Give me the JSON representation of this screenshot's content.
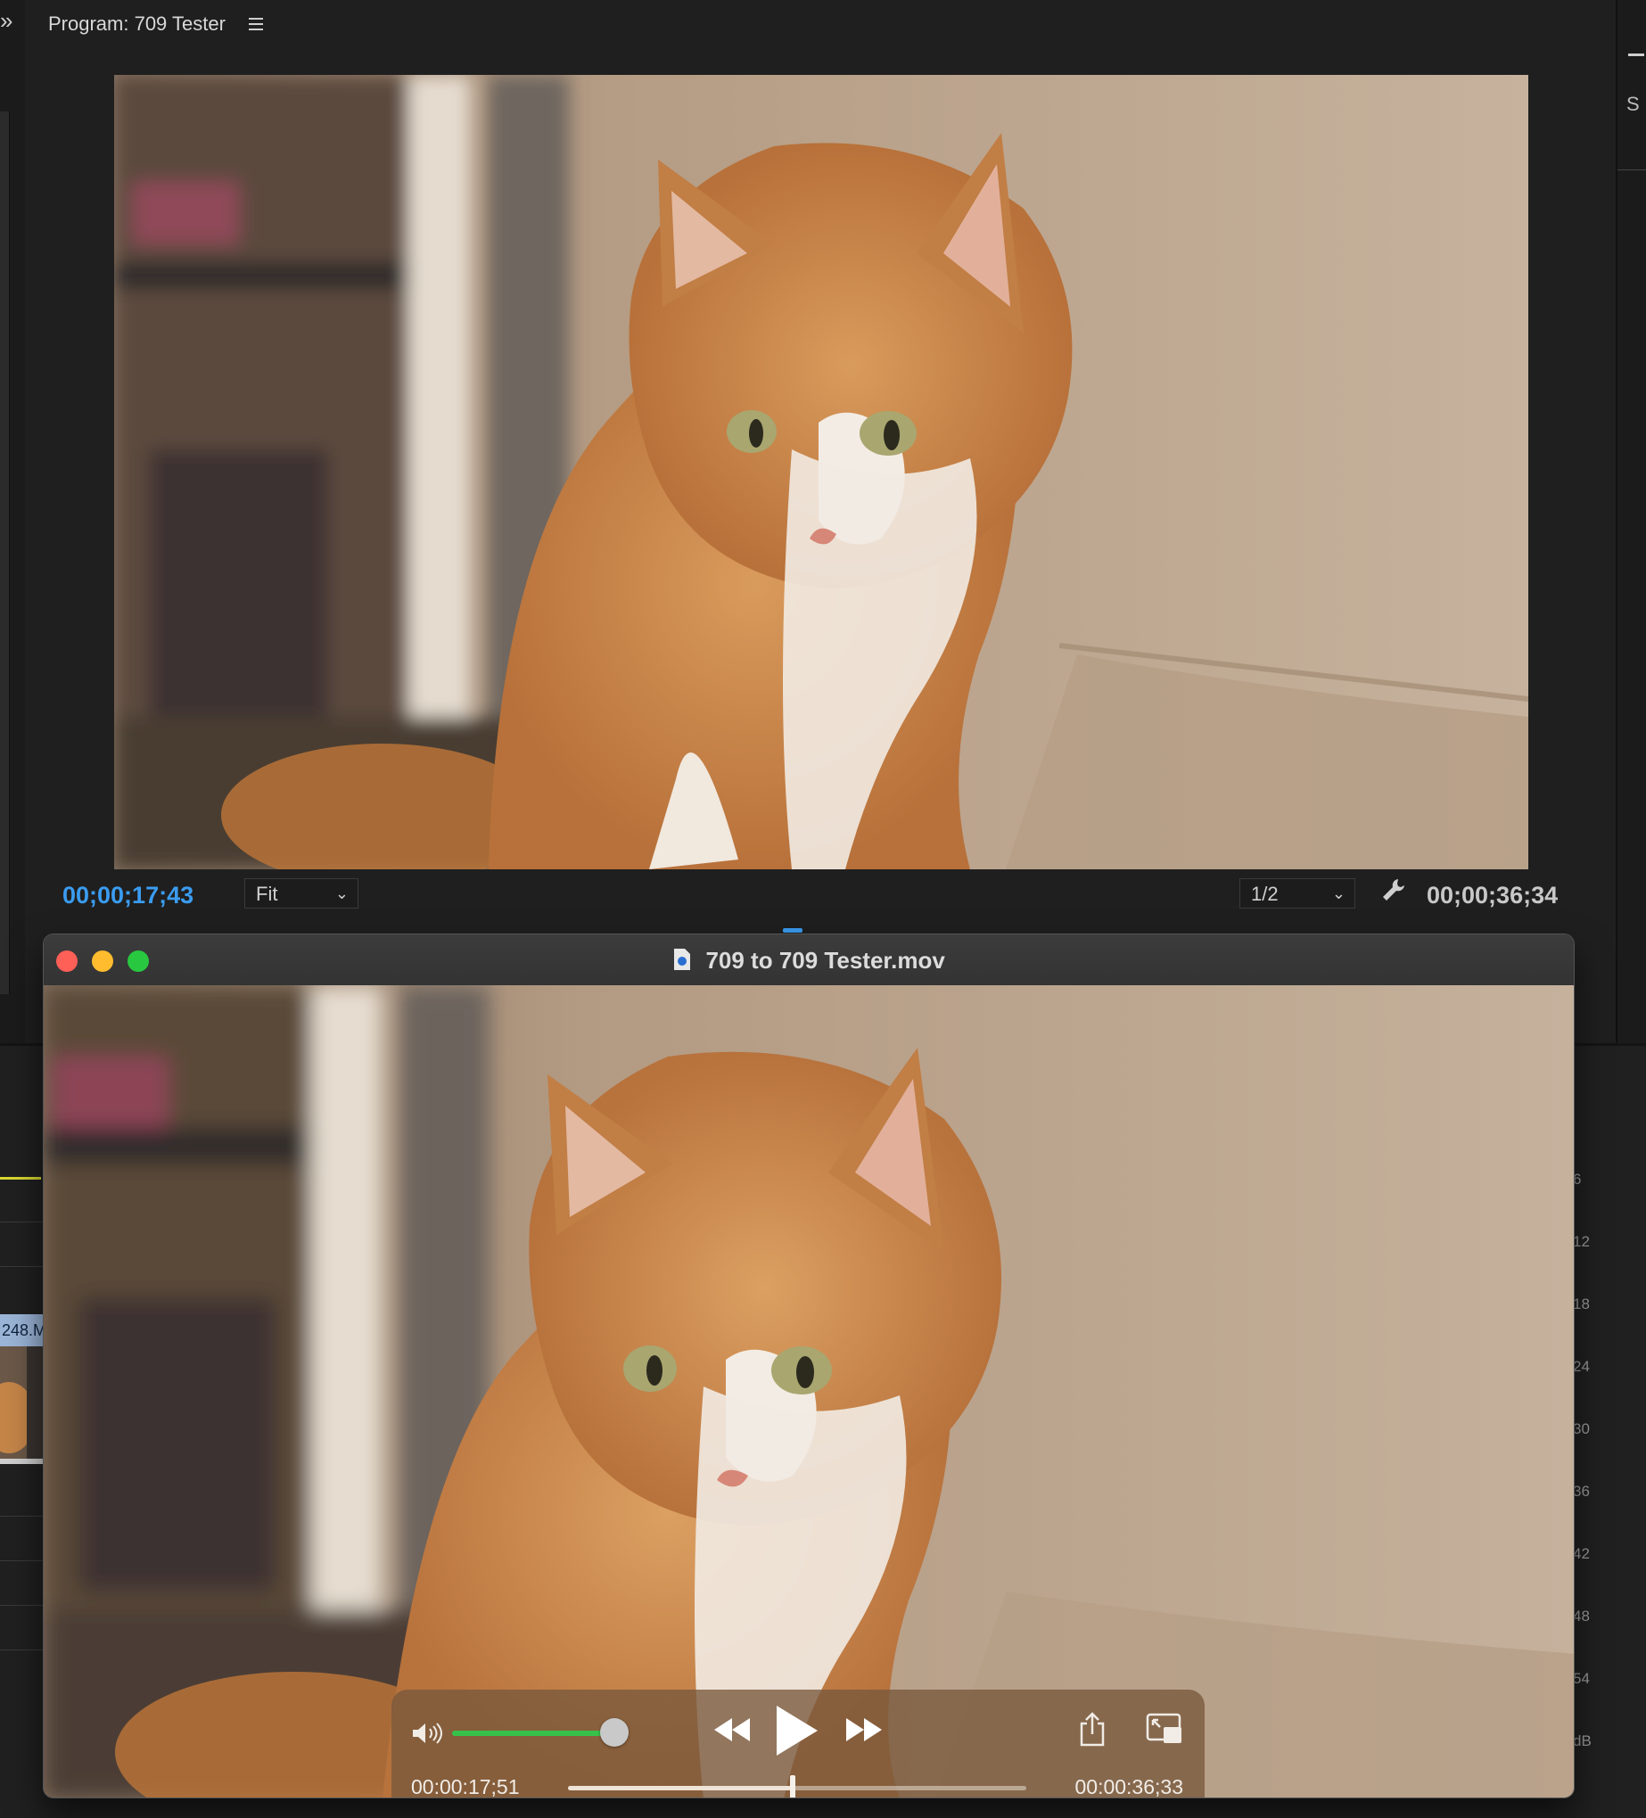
{
  "program_monitor": {
    "title": "Program: 709 Tester",
    "current_timecode": "00;00;17;43",
    "zoom": "Fit",
    "resolution": "1/2",
    "duration_timecode": "00;00;36;34"
  },
  "timeline": {
    "clip_label": "248.M",
    "audio_meter_ticks": [
      "6",
      "12",
      "18",
      "24",
      "30",
      "36",
      "42",
      "48",
      "54",
      "dB"
    ]
  },
  "quicktime": {
    "title": "709 to 709 Tester.mov",
    "elapsed": "00:00:17;51",
    "remaining": "00:00:36;33",
    "volume_level": 0.85,
    "playback_progress": 0.49,
    "colors": {
      "volume": "#36c24a",
      "close": "#fe5f57",
      "minimize": "#febc2e",
      "zoom": "#28c840",
      "timecode_accent": "#3b9cf0"
    }
  },
  "icons": [
    "menu-icon",
    "chevron-down-icon",
    "wrench-icon",
    "document-icon",
    "volume-icon",
    "rewind-icon",
    "play-icon",
    "fast-forward-icon",
    "share-icon",
    "picture-in-picture-icon"
  ]
}
